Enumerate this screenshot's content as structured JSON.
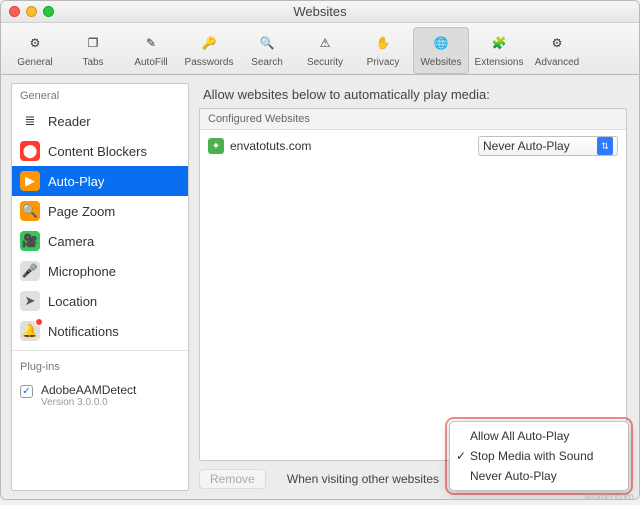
{
  "window": {
    "title": "Websites"
  },
  "toolbar": [
    {
      "label": "General",
      "icon": "⚙",
      "selected": false
    },
    {
      "label": "Tabs",
      "icon": "❐",
      "selected": false
    },
    {
      "label": "AutoFill",
      "icon": "✎",
      "selected": false
    },
    {
      "label": "Passwords",
      "icon": "🔑",
      "selected": false
    },
    {
      "label": "Search",
      "icon": "🔍",
      "selected": false
    },
    {
      "label": "Security",
      "icon": "⚠",
      "selected": false
    },
    {
      "label": "Privacy",
      "icon": "✋",
      "selected": false
    },
    {
      "label": "Websites",
      "icon": "🌐",
      "selected": true
    },
    {
      "label": "Extensions",
      "icon": "🧩",
      "selected": false
    },
    {
      "label": "Advanced",
      "icon": "⚙",
      "selected": false
    }
  ],
  "sidebar": {
    "group1": "General",
    "items": [
      {
        "label": "Reader",
        "color": "#fff",
        "icon": "≣",
        "iconColor": "#333"
      },
      {
        "label": "Content Blockers",
        "color": "#ff3b30",
        "icon": "⬤"
      },
      {
        "label": "Auto-Play",
        "color": "#ff9500",
        "icon": "▶",
        "selected": true
      },
      {
        "label": "Page Zoom",
        "color": "#ff9500",
        "icon": "🔍"
      },
      {
        "label": "Camera",
        "color": "#34c759",
        "icon": "🎥"
      },
      {
        "label": "Microphone",
        "color": "#e0e0e0",
        "icon": "🎤",
        "iconColor": "#555"
      },
      {
        "label": "Location",
        "color": "#e0e0e0",
        "icon": "➤",
        "iconColor": "#555"
      },
      {
        "label": "Notifications",
        "color": "#e0e0e0",
        "icon": "🔔",
        "iconColor": "#555",
        "badge": true
      }
    ],
    "group2": "Plug-ins",
    "plugin": {
      "name": "AdobeAAMDetect",
      "version": "Version 3.0.0.0",
      "checked": true
    }
  },
  "main": {
    "heading": "Allow websites below to automatically play media:",
    "box_header": "Configured Websites",
    "rows": [
      {
        "site": "envatotuts.com",
        "value": "Never Auto-Play"
      }
    ],
    "remove": "Remove",
    "footer_label": "When visiting other websites",
    "menu": [
      {
        "label": "Allow All Auto-Play",
        "checked": false
      },
      {
        "label": "Stop Media with Sound",
        "checked": true
      },
      {
        "label": "Never Auto-Play",
        "checked": false
      }
    ]
  },
  "watermark": "wsxdn.com"
}
